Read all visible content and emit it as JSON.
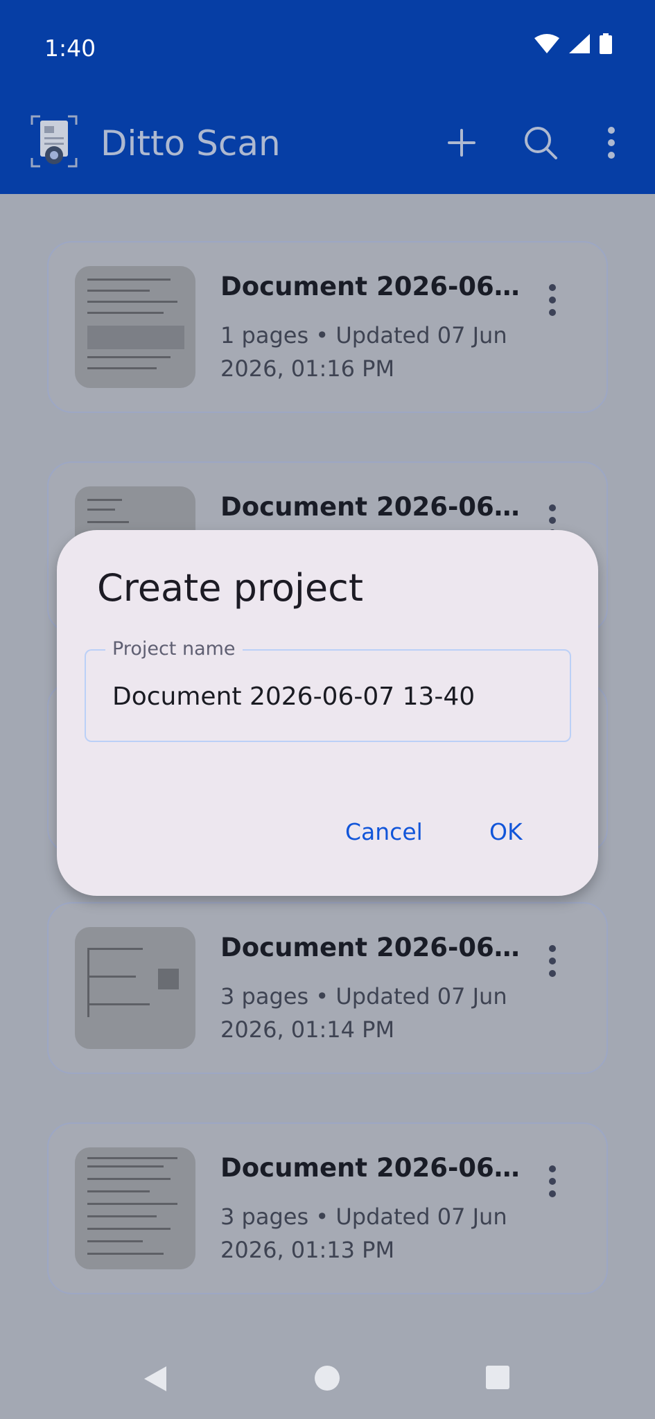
{
  "status_bar": {
    "time": "1:40"
  },
  "app_bar": {
    "title": "Ditto Scan",
    "actions": [
      "add-icon",
      "search-icon",
      "more-vertical-icon"
    ]
  },
  "projects": [
    {
      "title": "Document 2026-06-07…",
      "subtitle": "1 pages • Updated 07 Jun 2026, 01:16 PM"
    },
    {
      "title": "Document 2026-06-07…",
      "subtitle": ""
    },
    {
      "title": "",
      "subtitle": ""
    },
    {
      "title": "Document 2026-06-07…",
      "subtitle": "3 pages • Updated 07 Jun 2026, 01:14 PM"
    },
    {
      "title": "Document 2026-06-07…",
      "subtitle": "3 pages • Updated 07 Jun 2026, 01:13 PM"
    }
  ],
  "dialog": {
    "title": "Create project",
    "field_label": "Project name",
    "field_value": "Document 2026-06-07 13-40",
    "cancel": "Cancel",
    "ok": "OK"
  },
  "colors": {
    "app_bar": "#063EA5",
    "accent": "#1155D9",
    "dialog_bg": "#EDE7EF"
  }
}
